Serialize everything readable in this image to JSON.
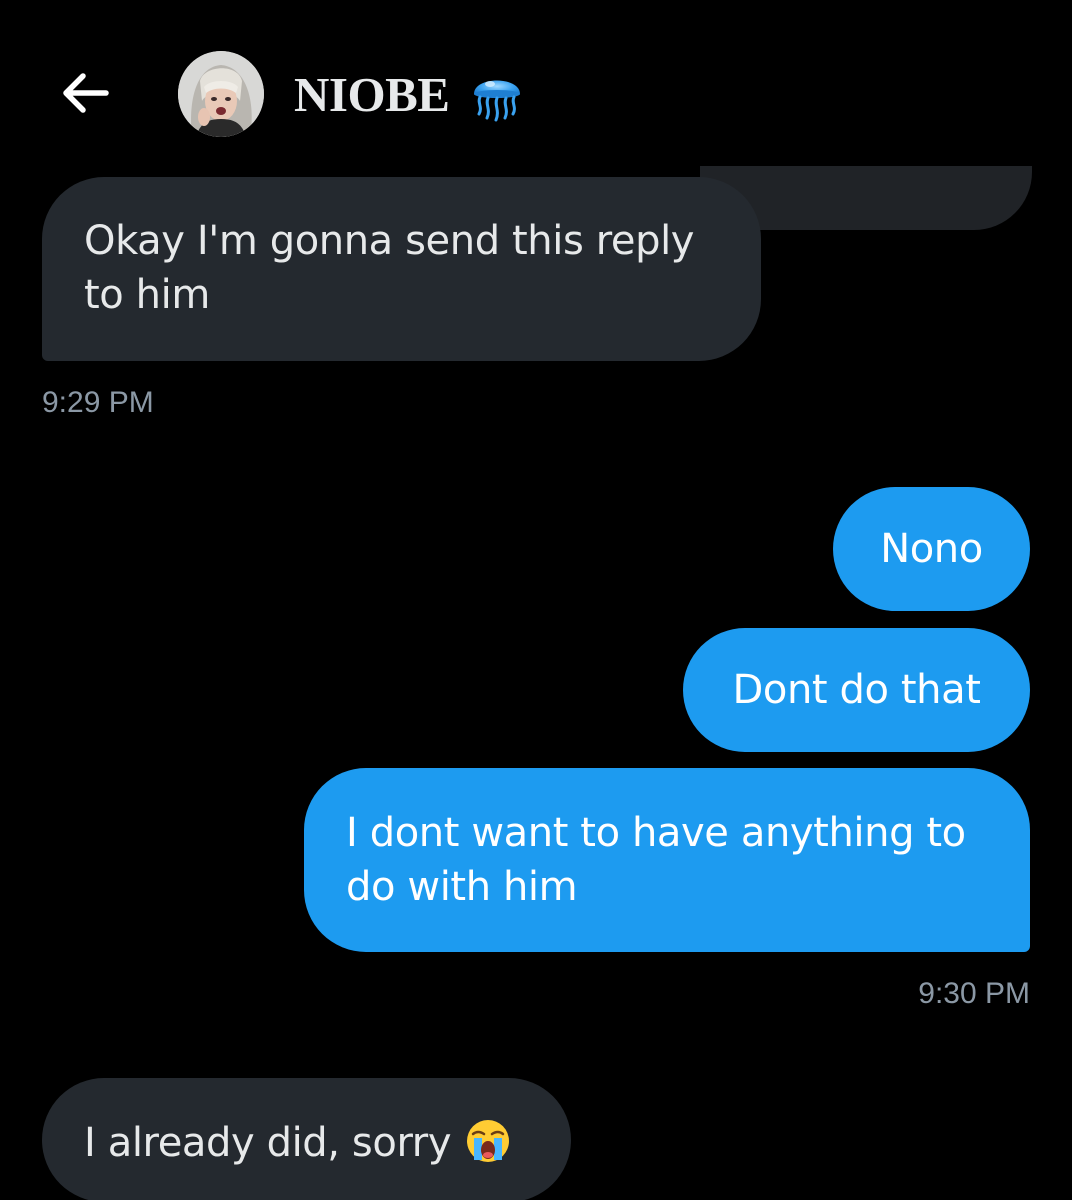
{
  "header": {
    "back_icon": "arrow-left-icon",
    "contact_name": "NIOBE",
    "name_emoji_icon": "jellyfish-icon",
    "avatar_icon": "profile-photo"
  },
  "colors": {
    "background": "#000000",
    "incoming_bubble": "#24292f",
    "outgoing_bubble": "#1d9bf0",
    "timestamp_text": "#8b98a5"
  },
  "messages": [
    {
      "direction": "incoming",
      "text": "Okay I'm gonna send this reply to him"
    },
    {
      "direction": "outgoing",
      "text": "Nono"
    },
    {
      "direction": "outgoing",
      "text": "Dont do that"
    },
    {
      "direction": "outgoing",
      "text": "I dont want to have anything to do with him"
    },
    {
      "direction": "incoming",
      "text": "I already did, sorry",
      "trailing_emoji_icon": "loudly-crying-face-icon"
    }
  ],
  "timestamps": {
    "incoming_group": "9:29 PM",
    "outgoing_group": "9:30 PM"
  }
}
